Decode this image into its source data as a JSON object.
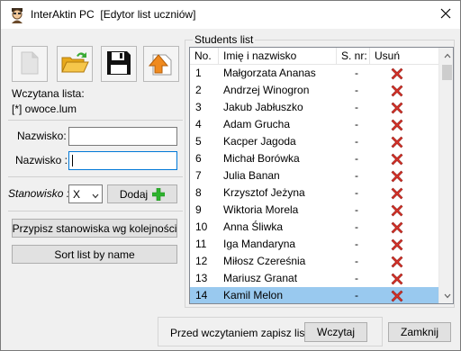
{
  "window": {
    "title": "InterAktin PC  [Edytor list uczniów]",
    "icons": {
      "app": "student-avatar-icon",
      "close": "close-icon"
    }
  },
  "toolbar": {
    "buttons": [
      {
        "name": "new-list-button",
        "icon": "blank-page-icon"
      },
      {
        "name": "open-list-button",
        "icon": "open-folder-icon"
      },
      {
        "name": "save-list-button",
        "icon": "floppy-disk-icon"
      },
      {
        "name": "export-list-button",
        "icon": "export-arrow-icon"
      }
    ]
  },
  "left": {
    "loaded_label": "Wczytana lista:",
    "loaded_file": "[*] owoce.lum",
    "nazwisko1_label": "Nazwisko:",
    "nazwisko1_value": "",
    "nazwisko2_label": "Nazwisko :",
    "nazwisko2_value": "",
    "stanowisko_label": "Stanowisko :",
    "stanowisko_value": "X",
    "add_button": "Dodaj",
    "assign_button": "Przypisz stanowiska wg kolejności",
    "sort_button": "Sort list by name"
  },
  "students": {
    "title": "Students list",
    "columns": [
      "No.",
      "Imię i nazwisko",
      "S. nr:",
      "Usuń"
    ],
    "rows": [
      {
        "no": "1",
        "name": "Małgorzata Ananas",
        "snr": "-"
      },
      {
        "no": "2",
        "name": "Andrzej Winogron",
        "snr": "-"
      },
      {
        "no": "3",
        "name": "Jakub Jabłuszko",
        "snr": "-"
      },
      {
        "no": "4",
        "name": "Adam Grucha",
        "snr": "-"
      },
      {
        "no": "5",
        "name": "Kacper Jagoda",
        "snr": "-"
      },
      {
        "no": "6",
        "name": "Michał Borówka",
        "snr": "-"
      },
      {
        "no": "7",
        "name": "Julia Banan",
        "snr": "-"
      },
      {
        "no": "8",
        "name": "Krzysztof Jeżyna",
        "snr": "-"
      },
      {
        "no": "9",
        "name": "Wiktoria Morela",
        "snr": "-"
      },
      {
        "no": "10",
        "name": "Anna Śliwka",
        "snr": "-"
      },
      {
        "no": "11",
        "name": "Iga Mandaryna",
        "snr": "-"
      },
      {
        "no": "12",
        "name": "Miłosz Czereśnia",
        "snr": "-"
      },
      {
        "no": "13",
        "name": "Mariusz Granat",
        "snr": "-"
      },
      {
        "no": "14",
        "name": "Kamil Melon",
        "snr": "-"
      }
    ],
    "selected_index": 13,
    "delete_icon": "red-x-delete-icon"
  },
  "bottom": {
    "hint": "Przed wczytaniem zapisz listę",
    "load_button": "Wczytaj",
    "close_button": "Zamknij"
  },
  "colors": {
    "selection": "#99c9ef",
    "delete_red": "#d9342b",
    "add_green": "#2db32d"
  }
}
